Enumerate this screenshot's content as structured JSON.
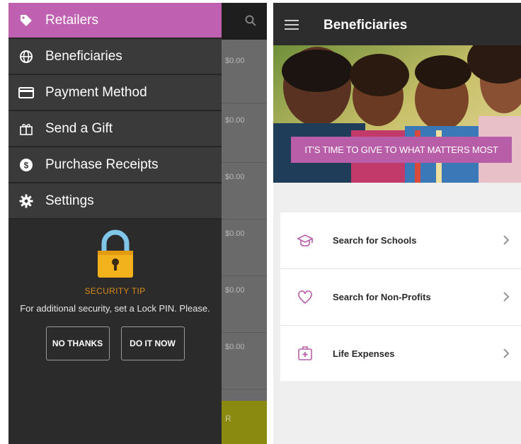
{
  "left_screen": {
    "drawer": {
      "menu": [
        {
          "label": "Retailers",
          "icon": "tag-icon",
          "active": true
        },
        {
          "label": "Beneficiaries",
          "icon": "globe-icon",
          "active": false
        },
        {
          "label": "Payment Method",
          "icon": "credit-card-icon",
          "active": false
        },
        {
          "label": "Send a Gift",
          "icon": "gift-icon",
          "active": false
        },
        {
          "label": "Purchase Receipts",
          "icon": "dollar-circle-icon",
          "active": false
        },
        {
          "label": "Settings",
          "icon": "gear-icon",
          "active": false
        }
      ],
      "security_tip": {
        "icon": "lock-icon",
        "title": "SECURITY TIP",
        "message": "For additional security, set a Lock PIN. Please.",
        "no_thanks": "NO THANKS",
        "do_it_now": "DO IT NOW"
      }
    },
    "background": {
      "amounts": [
        "$0.00",
        "$0.00",
        "$0.00",
        "$0.00",
        "$0.00",
        "$0.00"
      ],
      "bottom_text": "R"
    }
  },
  "right_screen": {
    "title": "Beneficiaries",
    "banner": "IT'S TIME TO GIVE TO WHAT MATTERS MOST",
    "rows": [
      {
        "label": "Search for Schools",
        "icon": "graduation-cap-icon"
      },
      {
        "label": "Search for Non-Profits",
        "icon": "heart-icon"
      },
      {
        "label": "Life Expenses",
        "icon": "medical-bag-icon"
      }
    ]
  },
  "colors": {
    "accent": "#c060b0",
    "banner": "#b85ea8",
    "drawer_bg": "#2b2b2b",
    "security_title": "#d68a1a",
    "topbar": "#2d2d2d"
  }
}
